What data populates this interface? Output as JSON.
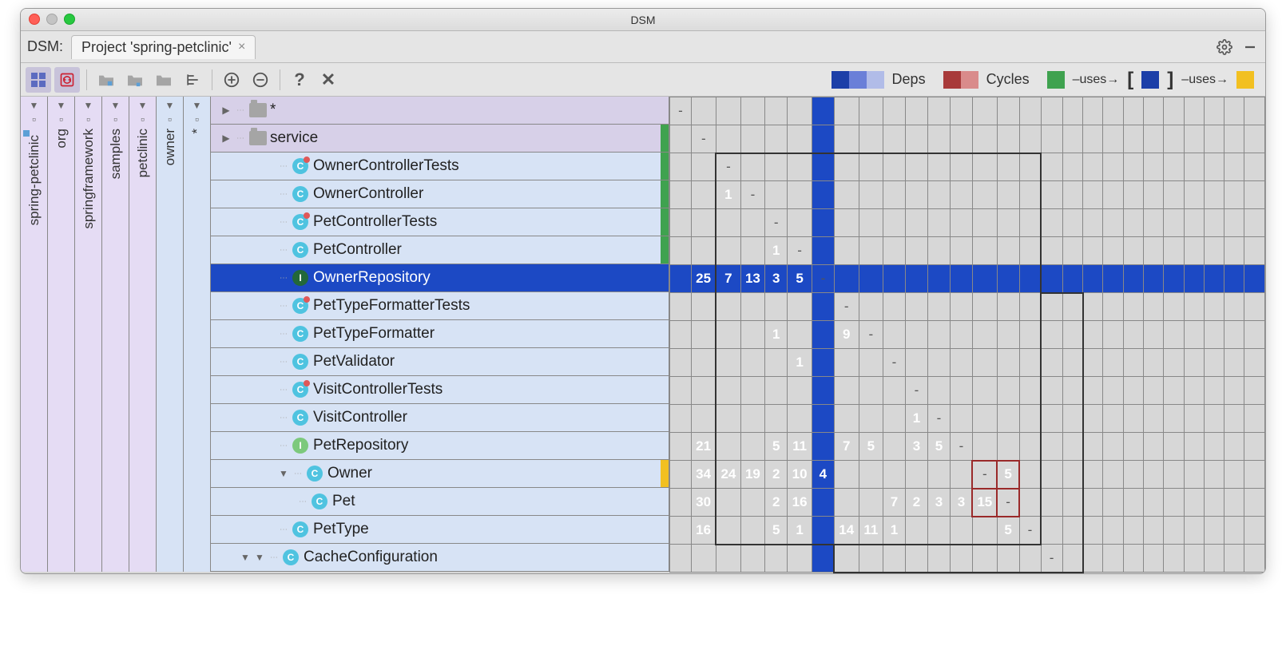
{
  "window": {
    "title": "DSM"
  },
  "tabbar": {
    "label": "DSM:",
    "tab_title": "Project 'spring-petclinic'"
  },
  "legend": {
    "deps": "Deps",
    "cycles": "Cycles",
    "uses1": "–uses→",
    "uses2": "–uses→"
  },
  "vcols": [
    {
      "label": "spring-petclinic"
    },
    {
      "label": "org"
    },
    {
      "label": "springframework"
    },
    {
      "label": "samples"
    },
    {
      "label": "petclinic"
    }
  ],
  "owner_col": {
    "label": "owner",
    "star": "*"
  },
  "rows": [
    {
      "id": "star",
      "label": "*",
      "type": "folder",
      "strip": "",
      "indent": 0
    },
    {
      "id": "service",
      "label": "service",
      "type": "folder",
      "strip": "green",
      "indent": 0
    },
    {
      "id": "oct",
      "label": "OwnerControllerTests",
      "type": "c-test",
      "strip": "green",
      "indent": 3
    },
    {
      "id": "oc",
      "label": "OwnerController",
      "type": "c",
      "strip": "green",
      "indent": 3
    },
    {
      "id": "pct",
      "label": "PetControllerTests",
      "type": "c-test",
      "strip": "green",
      "indent": 3
    },
    {
      "id": "pc",
      "label": "PetController",
      "type": "c",
      "strip": "green",
      "indent": 3
    },
    {
      "id": "or",
      "label": "OwnerRepository",
      "type": "i",
      "strip": "",
      "indent": 3,
      "selected": true
    },
    {
      "id": "ptft",
      "label": "PetTypeFormatterTests",
      "type": "c-test",
      "strip": "",
      "indent": 3
    },
    {
      "id": "ptf",
      "label": "PetTypeFormatter",
      "type": "c",
      "strip": "",
      "indent": 3
    },
    {
      "id": "pv",
      "label": "PetValidator",
      "type": "c",
      "strip": "",
      "indent": 3
    },
    {
      "id": "vct",
      "label": "VisitControllerTests",
      "type": "c-test",
      "strip": "",
      "indent": 3
    },
    {
      "id": "vc",
      "label": "VisitController",
      "type": "c",
      "strip": "",
      "indent": 3
    },
    {
      "id": "pr",
      "label": "PetRepository",
      "type": "i-light",
      "strip": "",
      "indent": 3
    },
    {
      "id": "owner",
      "label": "Owner",
      "type": "c",
      "strip": "yellow",
      "indent": 3,
      "expandable": true
    },
    {
      "id": "pet",
      "label": "Pet",
      "type": "c",
      "strip": "",
      "indent": 4
    },
    {
      "id": "pettype",
      "label": "PetType",
      "type": "c",
      "strip": "",
      "indent": 3
    },
    {
      "id": "cache",
      "label": "CacheConfiguration",
      "type": "c",
      "strip": "",
      "indent": 1,
      "bottom": true
    }
  ],
  "matrix": {
    "cols": 27,
    "diag_col_offset": 0,
    "cells": {
      "0": {
        "0": {
          "diag": true
        }
      },
      "1": {
        "1": {
          "diag": true
        }
      },
      "2": {
        "2": {
          "diag": true
        }
      },
      "3": {
        "2": {
          "v": "1",
          "c": "v1"
        },
        "3": {
          "diag": true
        }
      },
      "4": {
        "4": {
          "diag": true
        }
      },
      "5": {
        "4": {
          "v": "1",
          "c": "v1"
        },
        "5": {
          "diag": true
        }
      },
      "6": {
        "1": {
          "v": "25",
          "c": "v4"
        },
        "2": {
          "v": "7",
          "c": "v4"
        },
        "3": {
          "v": "13",
          "c": "v4"
        },
        "4": {
          "v": "3",
          "c": "v4"
        },
        "5": {
          "v": "5",
          "c": "v4"
        },
        "6": {
          "diag": true
        }
      },
      "7": {
        "7": {
          "diag": true
        }
      },
      "8": {
        "4": {
          "v": "1",
          "c": "v1"
        },
        "7": {
          "v": "9",
          "c": "v4"
        },
        "8": {
          "diag": true
        }
      },
      "9": {
        "5": {
          "v": "1",
          "c": "v1"
        },
        "9": {
          "diag": true
        }
      },
      "10": {
        "10": {
          "diag": true
        }
      },
      "11": {
        "10": {
          "v": "1",
          "c": "v1"
        },
        "11": {
          "diag": true
        }
      },
      "12": {
        "1": {
          "v": "21",
          "c": "v4"
        },
        "4": {
          "v": "5",
          "c": "v3"
        },
        "5": {
          "v": "11",
          "c": "v4"
        },
        "7": {
          "v": "7",
          "c": "v4"
        },
        "8": {
          "v": "5",
          "c": "v3"
        },
        "10": {
          "v": "3",
          "c": "v2"
        },
        "11": {
          "v": "5",
          "c": "v3"
        },
        "12": {
          "diag": true
        }
      },
      "13": {
        "1": {
          "v": "34",
          "c": "v4"
        },
        "2": {
          "v": "24",
          "c": "v4"
        },
        "3": {
          "v": "19",
          "c": "v4"
        },
        "4": {
          "v": "2",
          "c": "v2"
        },
        "5": {
          "v": "10",
          "c": "v4"
        },
        "6": {
          "v": "4",
          "c": "v4"
        },
        "13": {
          "diag": true,
          "cycbox": true
        },
        "14": {
          "v": "5",
          "c": "cyc1",
          "cycbox": true
        }
      },
      "14": {
        "1": {
          "v": "30",
          "c": "v4"
        },
        "4": {
          "v": "2",
          "c": "v2"
        },
        "5": {
          "v": "16",
          "c": "v4"
        },
        "9": {
          "v": "7",
          "c": "v3"
        },
        "10": {
          "v": "2",
          "c": "v2"
        },
        "11": {
          "v": "3",
          "c": "v2"
        },
        "12": {
          "v": "3",
          "c": "v2"
        },
        "13": {
          "v": "15",
          "c": "cyc2",
          "cycbox": true
        },
        "14": {
          "diag": true,
          "cycbox": true
        }
      },
      "15": {
        "1": {
          "v": "16",
          "c": "v4"
        },
        "4": {
          "v": "5",
          "c": "v3"
        },
        "5": {
          "v": "1",
          "c": "v1"
        },
        "7": {
          "v": "14",
          "c": "v4"
        },
        "8": {
          "v": "11",
          "c": "v4"
        },
        "9": {
          "v": "1",
          "c": "v1"
        },
        "14": {
          "v": "5",
          "c": "v2"
        },
        "15": {
          "diag": true
        }
      },
      "16": {
        "16": {
          "diag": true
        }
      }
    },
    "highlight_row": 6,
    "highlight_col": 6,
    "region1": {
      "r0": 2,
      "r1": 15,
      "c0": 2,
      "c1": 15
    },
    "region2": {
      "r0": 7,
      "r1": 16,
      "c0": 7,
      "c1": 17
    }
  }
}
